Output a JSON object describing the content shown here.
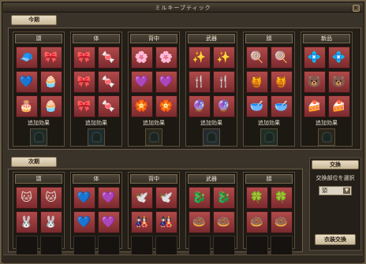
{
  "window": {
    "title": "ミルキーブティック",
    "close_label": "×"
  },
  "current": {
    "tab_label": "今期",
    "effect_label": "追加効果",
    "columns": [
      {
        "name": "頭",
        "slots": [
          "🧢",
          "🎀",
          "💙",
          "🧁",
          "🎂",
          "🧁"
        ],
        "effect_color": "#1e2a26"
      },
      {
        "name": "体",
        "slots": [
          "🎀",
          "🍬",
          "🎀",
          "🍬",
          "🎀",
          "🍬"
        ],
        "effect_color": "#1c2a2e"
      },
      {
        "name": "背中",
        "slots": [
          "🌸",
          "🌸",
          "💜",
          "💜",
          "🏵️",
          "🏵️"
        ],
        "effect_color": "#2a2618"
      },
      {
        "name": "武器",
        "slots": [
          "✨",
          "✨",
          "🍴",
          "🍴",
          "🔮",
          "🔮"
        ],
        "effect_color": "#262a30"
      },
      {
        "name": "顔",
        "slots": [
          "🍭",
          "🍭",
          "🍯",
          "🍯",
          "🥣",
          "🥣"
        ],
        "effect_color": "#1e2e22"
      },
      {
        "name": "新品",
        "slots": [
          "💠",
          "💠",
          "🐻",
          "🐻",
          "🍰",
          "🍰"
        ],
        "effect_color": "#2a2418"
      }
    ]
  },
  "next": {
    "tab_label": "次期",
    "columns": [
      {
        "name": "頭",
        "slots": [
          "🐱",
          "🐱",
          "🐰",
          "🐰",
          "",
          ""
        ]
      },
      {
        "name": "体",
        "slots": [
          "💙",
          "💜",
          "💙",
          "💜",
          "",
          ""
        ]
      },
      {
        "name": "背中",
        "slots": [
          "🕊️",
          "🕊️",
          "🎎",
          "🎎",
          "",
          ""
        ]
      },
      {
        "name": "武器",
        "slots": [
          "🐉",
          "🐉",
          "🍩",
          "🍩",
          "",
          ""
        ]
      },
      {
        "name": "顔",
        "slots": [
          "🍀",
          "🍀",
          "🍩",
          "🍩",
          "",
          ""
        ]
      }
    ]
  },
  "exchange": {
    "title": "交換",
    "instruction": "交換部位を選択",
    "selected_part": "頭",
    "dropdown_arrow": "▼",
    "button_label": "衣装交換"
  }
}
